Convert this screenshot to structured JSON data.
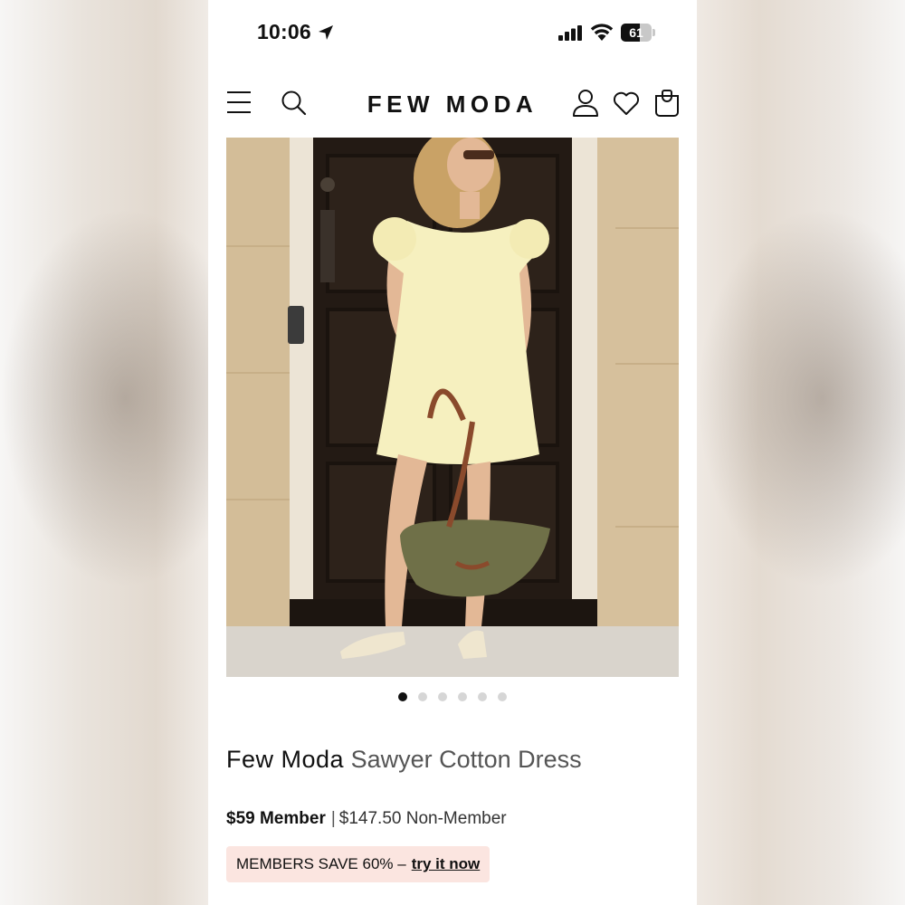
{
  "status_bar": {
    "time": "10:06",
    "battery_level": "61",
    "battery_fraction": 0.61,
    "icons": [
      "location-arrow-icon",
      "cellular-signal-icon",
      "wifi-icon",
      "battery-icon"
    ]
  },
  "header": {
    "logo": "FEW MODA",
    "icons": [
      "menu-icon",
      "search-icon",
      "account-icon",
      "heart-icon",
      "shopping-bag-icon"
    ]
  },
  "carousel": {
    "total_slides": 6,
    "active_index": 0
  },
  "product": {
    "brand": "Few Moda",
    "name": "Sawyer Cotton Dress",
    "member_price": "$59 Member",
    "separator": "|",
    "non_member_price": "$147.50 Non-Member"
  },
  "promo": {
    "text": "MEMBERS SAVE 60% –",
    "link": "try it now"
  },
  "colors": {
    "accent_text": "#111111",
    "promo_background": "#fbe5e0",
    "dot_active": "#111111",
    "dot_inactive": "#d6d6d6"
  }
}
